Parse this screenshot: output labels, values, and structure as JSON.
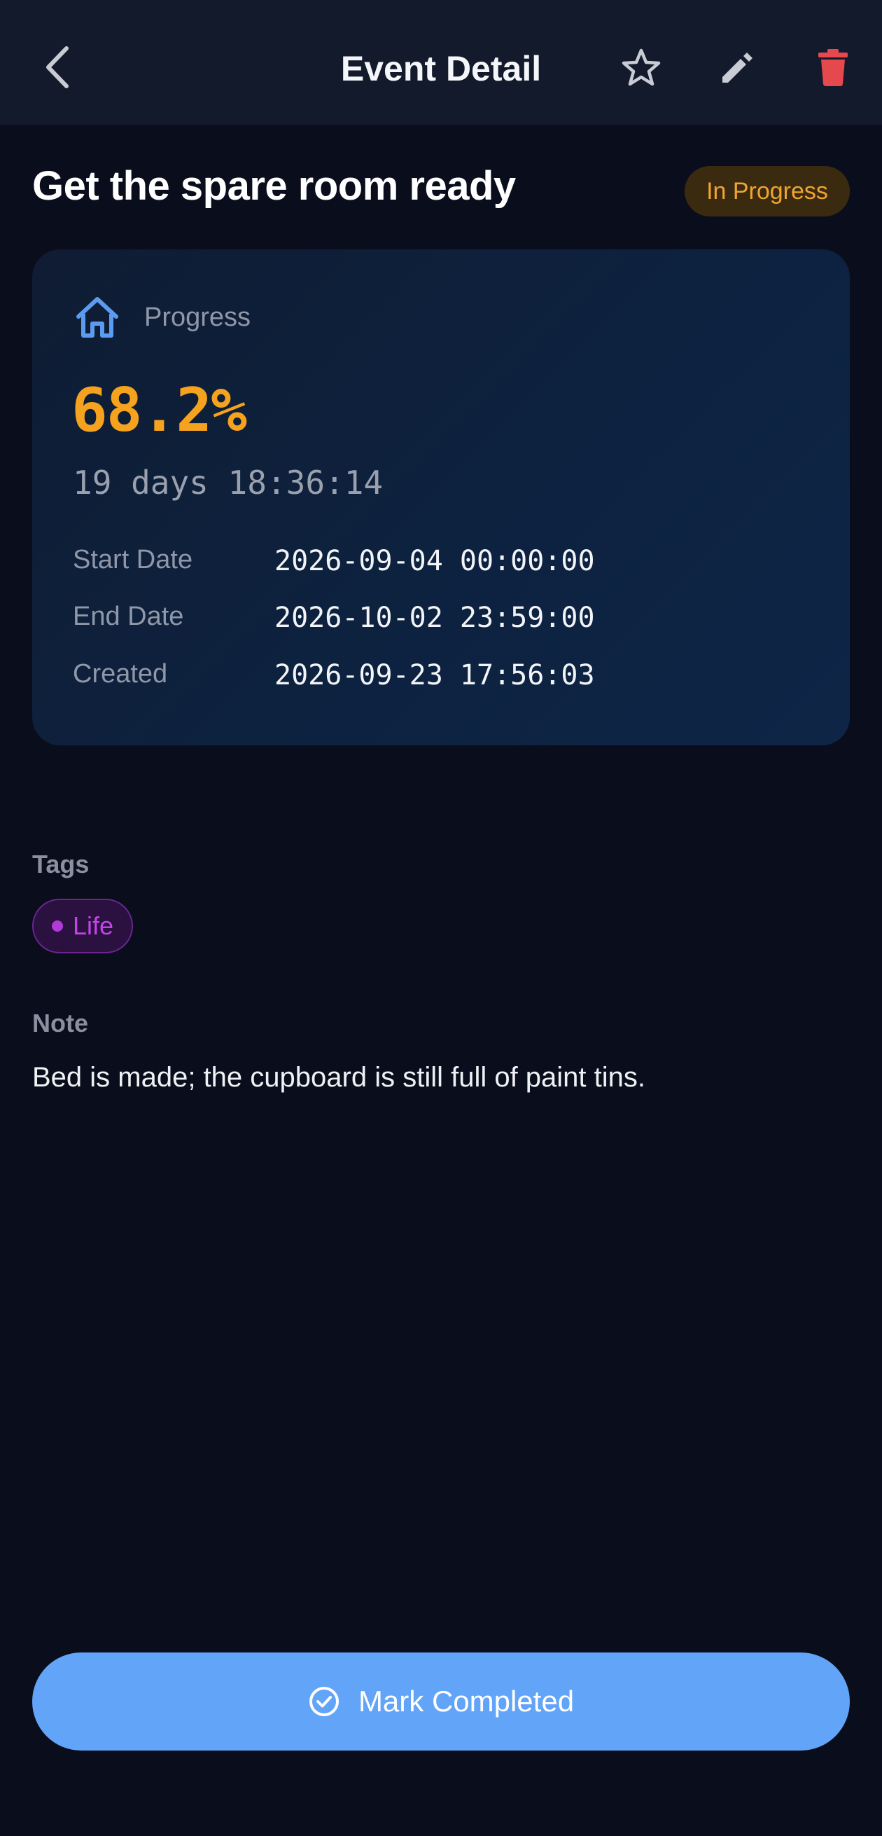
{
  "appbar": {
    "title": "Event Detail",
    "icons": {
      "back": "chevron-left-icon",
      "favorite": "star-outline-icon",
      "edit": "pencil-icon",
      "delete": "trash-icon"
    }
  },
  "event": {
    "title": "Get the spare room ready",
    "status": "In Progress",
    "category_icon": "home-icon"
  },
  "progress": {
    "label": "Progress",
    "percent_text": "68.2%",
    "percent_value": 68.2,
    "countdown": "19 days 18:36:14"
  },
  "details": [
    {
      "key": "Start Date",
      "value": "2026-09-04 00:00:00"
    },
    {
      "key": "End Date",
      "value": "2026-10-02 23:59:00"
    },
    {
      "key": "Created",
      "value": "2026-09-23 17:56:03"
    }
  ],
  "tags": {
    "label": "Tags",
    "items": [
      {
        "name": "Life",
        "color": "#c445e6"
      }
    ]
  },
  "note": {
    "label": "Note",
    "text": "Bed is made; the cupboard is still full of paint tins."
  },
  "action": {
    "label": "Mark Completed",
    "icon": "check-circle-icon"
  },
  "colors": {
    "background": "#0a0e1c",
    "appbar": "#131a2b",
    "accent": "#62a4f8",
    "progress": "#f5a21f",
    "status_text": "#f0a531",
    "delete": "#e5484d"
  }
}
